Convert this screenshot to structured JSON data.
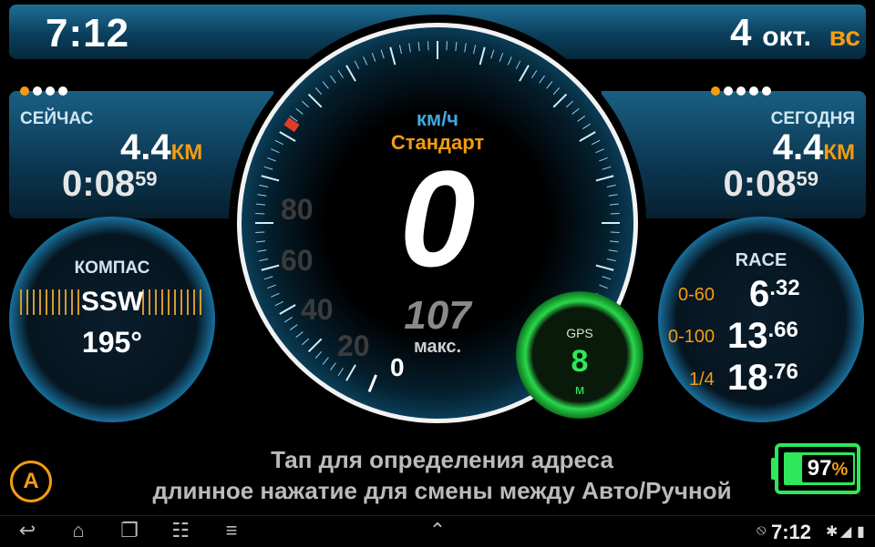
{
  "header": {
    "time": "7:12",
    "day": "4",
    "month": "окт.",
    "weekday": "вс"
  },
  "left_panel": {
    "label": "СЕЙЧАС",
    "distance": "4.4",
    "distance_unit": "КМ",
    "duration": "0:08",
    "duration_seconds": "59"
  },
  "right_panel": {
    "label": "СЕГОДНЯ",
    "distance": "4.4",
    "distance_unit": "КМ",
    "duration": "0:08",
    "duration_seconds": "59"
  },
  "compass": {
    "title": "КОМПАС",
    "direction": "SSW",
    "degrees": "195°"
  },
  "race": {
    "title": "RACE",
    "rows": [
      {
        "label": "0-60",
        "value": "6",
        "fraction": ".32"
      },
      {
        "label": "0-100",
        "value": "13",
        "fraction": ".66"
      },
      {
        "label": "1/4",
        "value": "18",
        "fraction": ".76"
      }
    ]
  },
  "speedometer": {
    "unit": "км/ч",
    "mode": "Стандарт",
    "speed": "0",
    "max_speed": "107",
    "max_label": "макс.",
    "scale_labels": [
      "80",
      "60",
      "40",
      "20",
      "0"
    ]
  },
  "gps": {
    "label": "GPS",
    "accuracy": "8",
    "unit": "м"
  },
  "hint": {
    "line1": "Тап для определения адреса",
    "line2": "длинное нажатие для смены между Авто/Ручной"
  },
  "auto_button": "A",
  "battery": {
    "value": "97",
    "unit": "%"
  },
  "system_bar": {
    "time": "7:12"
  },
  "colors": {
    "accent": "#f39c12",
    "gauge_blue": "#2aa0d6",
    "gps_green": "#2ee85a"
  }
}
